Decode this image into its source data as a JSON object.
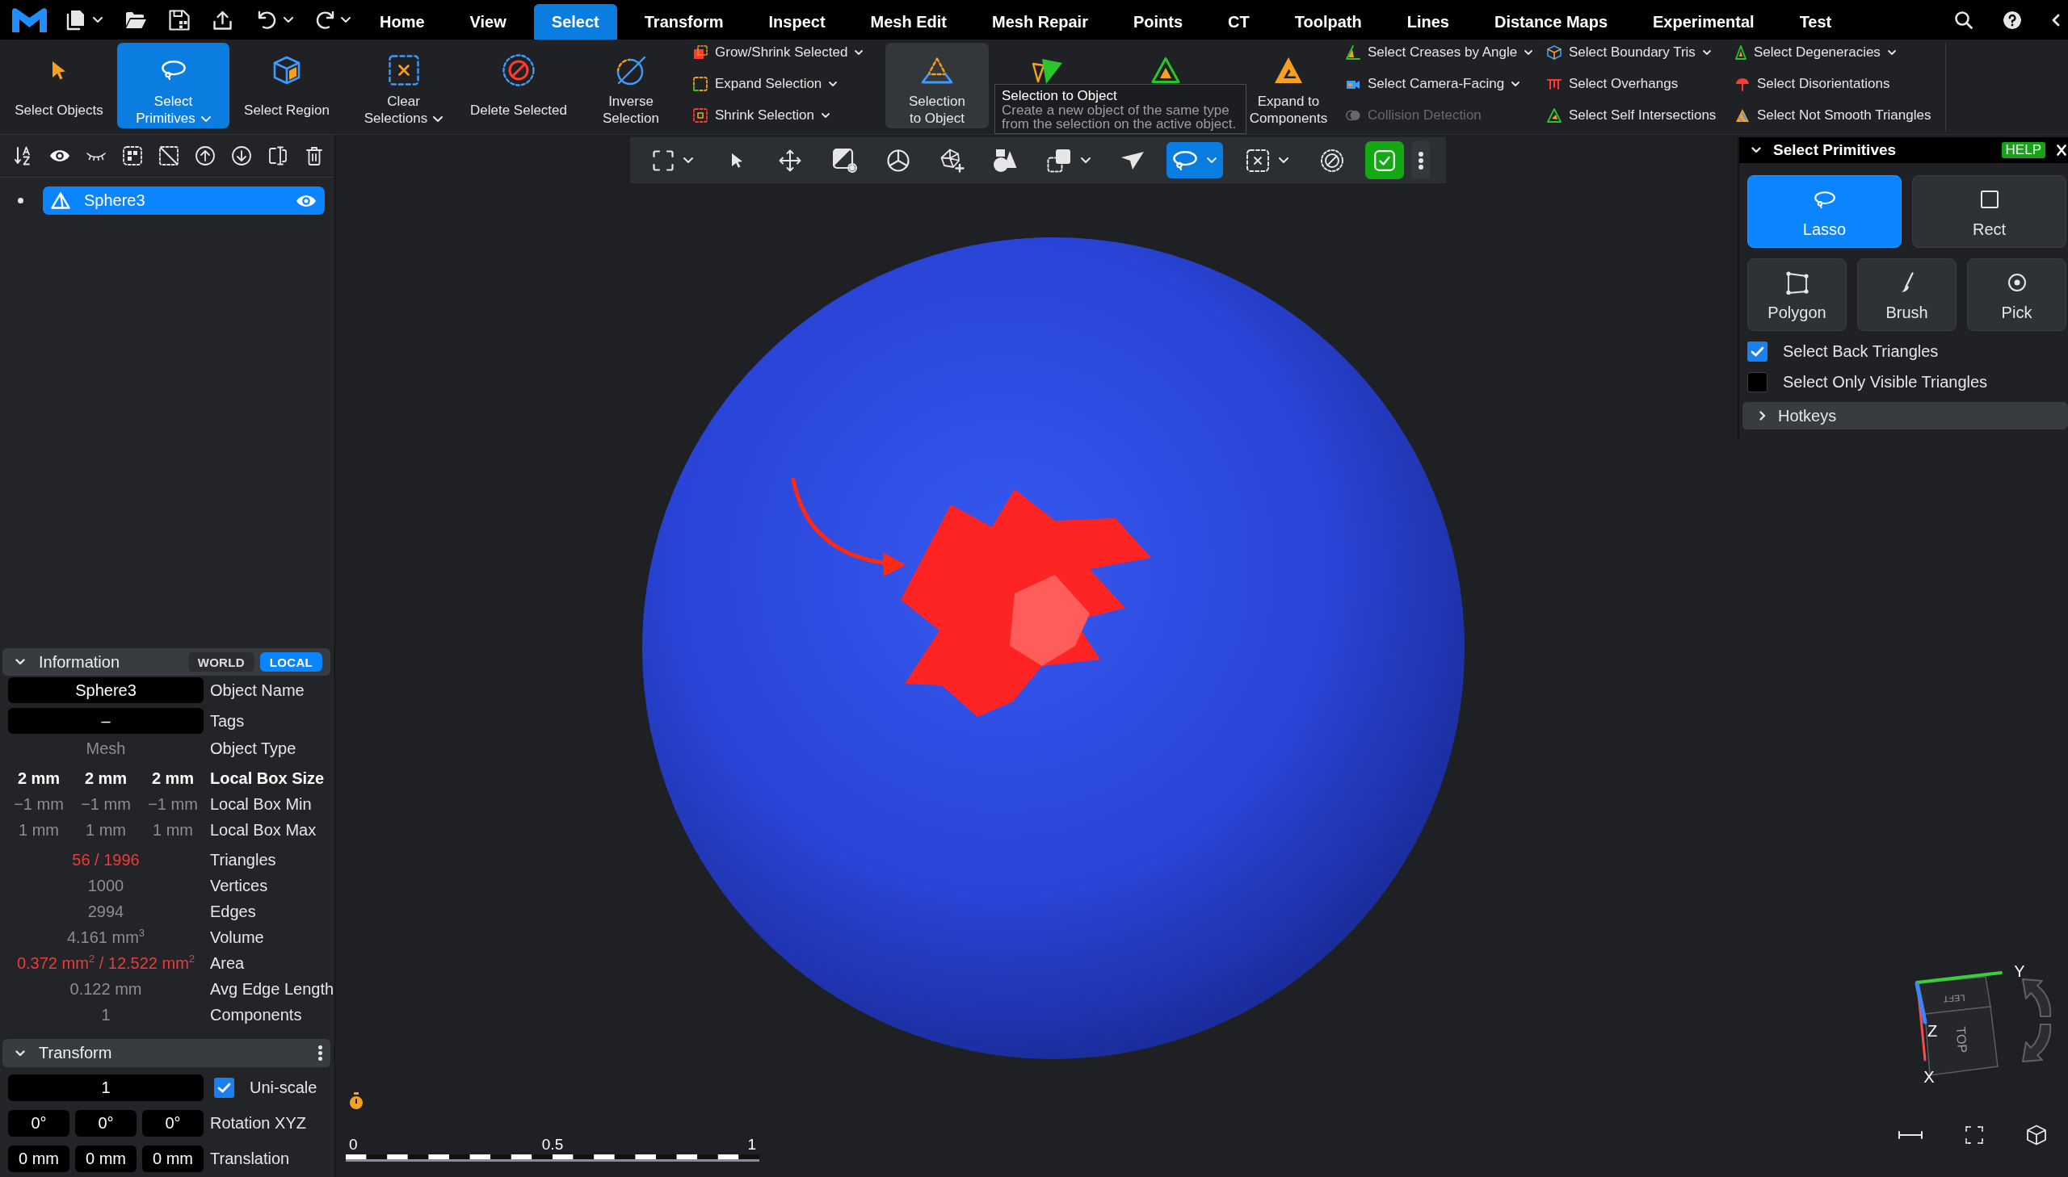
{
  "menu_bar": {
    "tabs": [
      {
        "label": "Home",
        "selected": false
      },
      {
        "label": "View",
        "selected": false
      },
      {
        "label": "Select",
        "selected": true
      },
      {
        "label": "Transform",
        "selected": false
      },
      {
        "label": "Inspect",
        "selected": false
      },
      {
        "label": "Mesh Edit",
        "selected": false
      },
      {
        "label": "Mesh Repair",
        "selected": false
      },
      {
        "label": "Points",
        "selected": false
      },
      {
        "label": "CT",
        "selected": false
      },
      {
        "label": "Toolpath",
        "selected": false
      },
      {
        "label": "Lines",
        "selected": false
      },
      {
        "label": "Distance Maps",
        "selected": false
      },
      {
        "label": "Experimental",
        "selected": false
      },
      {
        "label": "Test",
        "selected": false
      }
    ]
  },
  "ribbon": {
    "groups": [
      {
        "kind": "large",
        "lines": [
          "Select Objects"
        ],
        "selected": false,
        "hovered": false,
        "dropdown": false
      },
      {
        "kind": "large",
        "lines": [
          "Select",
          "Primitives"
        ],
        "selected": true,
        "hovered": false,
        "dropdown": true
      },
      {
        "kind": "large",
        "lines": [
          "Select Region"
        ],
        "selected": false,
        "hovered": false,
        "dropdown": false
      },
      {
        "kind": "large",
        "lines": [
          "Clear",
          "Selections"
        ],
        "selected": false,
        "hovered": false,
        "dropdown": true
      },
      {
        "kind": "large",
        "lines": [
          "Delete Selected"
        ],
        "selected": false,
        "hovered": false,
        "dropdown": false
      },
      {
        "kind": "large",
        "lines": [
          "Inverse",
          "Selection"
        ],
        "selected": false,
        "hovered": false,
        "dropdown": false
      },
      {
        "kind": "column",
        "items": [
          {
            "label": "Grow/Shrink Selected",
            "dropdown": true,
            "disabled": false
          },
          {
            "label": "Expand Selection",
            "dropdown": true,
            "disabled": false
          },
          {
            "label": "Shrink Selection",
            "dropdown": true,
            "disabled": false
          }
        ]
      },
      {
        "kind": "large",
        "lines": [
          "Selection",
          "to Object"
        ],
        "selected": false,
        "hovered": true,
        "dropdown": false
      },
      {
        "kind": "large",
        "selected": false,
        "hovered": false
      },
      {
        "kind": "large",
        "selected": false,
        "hovered": false
      },
      {
        "kind": "large",
        "lines": [
          "Expand to",
          "Components"
        ],
        "selected": false,
        "hovered": false,
        "dropdown": false
      },
      {
        "kind": "column",
        "items": [
          {
            "label": "Select Creases by Angle",
            "dropdown": true,
            "disabled": false
          },
          {
            "label": "Select Camera-Facing",
            "dropdown": true,
            "disabled": false
          },
          {
            "label": "Collision Detection",
            "dropdown": false,
            "disabled": true
          }
        ]
      },
      {
        "kind": "column",
        "items": [
          {
            "label": "Select Boundary Tris",
            "dropdown": true,
            "disabled": false
          },
          {
            "label": "Select Overhangs",
            "dropdown": false,
            "disabled": false
          },
          {
            "label": "Select Self Intersections",
            "dropdown": false,
            "disabled": false
          }
        ]
      },
      {
        "kind": "column",
        "items": [
          {
            "label": "Select Degeneracies",
            "dropdown": true,
            "disabled": false
          },
          {
            "label": "Select Disorientations",
            "dropdown": false,
            "disabled": false
          },
          {
            "label": "Select Not Smooth Triangles",
            "dropdown": false,
            "disabled": false
          }
        ]
      }
    ]
  },
  "tooltip": {
    "title": "Selection to Object",
    "text": "Create a new object of the same type from the selection on the active object."
  },
  "object_tree": {
    "items": [
      {
        "name": "Sphere3",
        "selected": true,
        "visible": true
      }
    ]
  },
  "information": {
    "title": "Information",
    "expanded": true,
    "frames": [
      {
        "label": "WORLD",
        "selected": false
      },
      {
        "label": "LOCAL",
        "selected": true
      }
    ],
    "rows": [
      {
        "kind": "field",
        "value": "Sphere3",
        "label": "Object Name"
      },
      {
        "kind": "field",
        "value": "–",
        "label": "Tags"
      },
      {
        "kind": "value",
        "value": "Mesh",
        "bold": false,
        "alert": false,
        "label": "Object Type"
      },
      {
        "kind": "triple",
        "values": [
          "2 mm",
          "2 mm",
          "2 mm"
        ],
        "bold": true,
        "alert": false,
        "label": "Local Box Size"
      },
      {
        "kind": "triple",
        "values": [
          "−1 mm",
          "−1 mm",
          "−1 mm"
        ],
        "bold": false,
        "alert": false,
        "label": "Local Box Min"
      },
      {
        "kind": "triple",
        "values": [
          "1 mm",
          "1 mm",
          "1 mm"
        ],
        "bold": false,
        "alert": false,
        "label": "Local Box Max"
      },
      {
        "kind": "value",
        "value": "56 / 1996",
        "bold": false,
        "alert": true,
        "label": "Triangles"
      },
      {
        "kind": "value",
        "value": "1000",
        "bold": false,
        "alert": false,
        "label": "Vertices"
      },
      {
        "kind": "value",
        "value": "2994",
        "bold": false,
        "alert": false,
        "label": "Edges"
      },
      {
        "kind": "value",
        "value": "4.161 mm$^{3}$",
        "bold": false,
        "alert": false,
        "label": "Volume"
      },
      {
        "kind": "value",
        "value": "0.372 mm$^{2}$ / 12.522 mm$^{2}$",
        "bold": false,
        "alert": true,
        "label": "Area"
      },
      {
        "kind": "value",
        "value": "0.122 mm",
        "bold": false,
        "alert": false,
        "label": "Avg Edge Length"
      },
      {
        "kind": "value",
        "value": "1",
        "bold": false,
        "alert": false,
        "label": "Components"
      }
    ]
  },
  "transform": {
    "title": "Transform",
    "expanded": true,
    "rows": [
      {
        "kind": "scale",
        "value": "1",
        "checked": true,
        "label": "Uni-scale"
      },
      {
        "kind": "fields",
        "values": [
          "0°",
          "0°",
          "0°"
        ],
        "label": "Rotation XYZ"
      },
      {
        "kind": "fields",
        "values": [
          "0 mm",
          "0 mm",
          "0 mm"
        ],
        "label": "Translation"
      }
    ]
  },
  "viewport": {
    "toolbar": [
      {
        "kind": "tool",
        "selected": false,
        "dropdown": true
      },
      {
        "kind": "tool",
        "selected": false,
        "dropdown": false
      },
      {
        "kind": "tool",
        "selected": false,
        "dropdown": false
      },
      {
        "kind": "tool",
        "selected": false,
        "dropdown": false
      },
      {
        "kind": "tool",
        "selected": false,
        "dropdown": false
      },
      {
        "kind": "tool",
        "selected": false,
        "dropdown": false
      },
      {
        "kind": "tool",
        "selected": false,
        "dropdown": false
      },
      {
        "kind": "tool",
        "selected": false,
        "dropdown": true
      },
      {
        "kind": "tool",
        "selected": false,
        "dropdown": false
      },
      {
        "kind": "tool",
        "selected": true,
        "dropdown": true
      },
      {
        "kind": "tool",
        "selected": false,
        "dropdown": true
      },
      {
        "kind": "tool",
        "selected": false,
        "dropdown": false
      },
      {
        "kind": "toggle",
        "on": true
      },
      {
        "kind": "menu"
      }
    ],
    "scale_bar": {
      "labels": [
        "0",
        "0.5",
        "1"
      ]
    },
    "view_cube": {
      "axes": [
        "Y",
        "Z",
        "X"
      ],
      "faces": [
        "LEFT",
        "TOP"
      ]
    }
  },
  "select_primitives": {
    "title": "Select Primitives",
    "expanded": true,
    "help": "HELP",
    "modes": [
      {
        "label": "Lasso",
        "selected": true
      },
      {
        "label": "Rect",
        "selected": false
      },
      {
        "label": "Polygon",
        "selected": false
      },
      {
        "label": "Brush",
        "selected": false
      },
      {
        "label": "Pick",
        "selected": false
      }
    ],
    "options": [
      {
        "label": "Select Back Triangles",
        "checked": true
      },
      {
        "label": "Select Only Visible Triangles",
        "checked": false
      }
    ],
    "hotkeys": {
      "label": "Hotkeys",
      "expanded": false
    }
  }
}
